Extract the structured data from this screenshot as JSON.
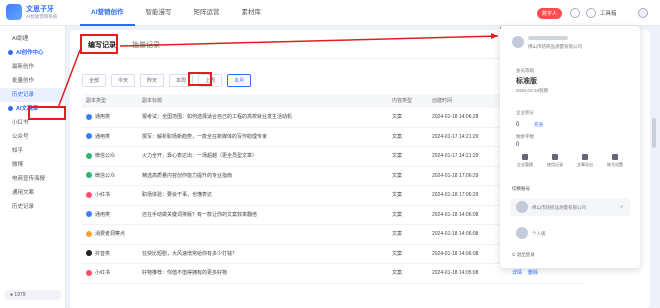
{
  "logo": {
    "title": "文思子牙",
    "subtitle": "AI智能营销系统"
  },
  "nav": [
    "AI营销创作",
    "智能漫写",
    "矩阵运营",
    "素材库"
  ],
  "header": {
    "user_badge": "数字人",
    "tools_label": "工具箱"
  },
  "sidebar": {
    "items": [
      {
        "label": "AI助理",
        "type": "item"
      },
      {
        "label": "AI创作中心",
        "type": "head"
      },
      {
        "label": "最新创作",
        "type": "item"
      },
      {
        "label": "批量创作",
        "type": "item"
      },
      {
        "label": "历史记录",
        "type": "item",
        "active": true
      },
      {
        "label": "AI文案库",
        "type": "head"
      },
      {
        "label": "小红书",
        "type": "item"
      },
      {
        "label": "公众号",
        "type": "item"
      },
      {
        "label": "知乎",
        "type": "item"
      },
      {
        "label": "微博",
        "type": "item"
      },
      {
        "label": "电商宣传海报",
        "type": "item"
      },
      {
        "label": "通用文案",
        "type": "item"
      },
      {
        "label": "历史记录",
        "type": "item"
      }
    ],
    "footer": "1979"
  },
  "tabs": [
    "编写记录",
    "批量记录"
  ],
  "filters": [
    "全部",
    "今天",
    "昨天",
    "本周",
    "上周",
    "本月"
  ],
  "table": {
    "headers": [
      "副本类型",
      "副本标题",
      "内容类型",
      "创建时间"
    ],
    "rows": [
      {
        "type": "通用类",
        "title": "报考试：全国范围：如何选择适合自己的工程的高校就业发生活动机",
        "ctype": "文案",
        "time": "2024-01-18 14:06:28",
        "color": "#3b7cff"
      },
      {
        "type": "通用类",
        "title": "撰写：解析职场新趋势，一款全在新媒体的写作助理专家",
        "ctype": "文案",
        "time": "2024-01-17 14:21:29",
        "color": "#3b7cff"
      },
      {
        "type": "微信公众",
        "title": "火力全开，靠心表达出：一场超越（更全员型文章）",
        "ctype": "文案",
        "time": "2024-01-17 14:21:29",
        "color": "#2bb673"
      },
      {
        "type": "微信公众",
        "title": "精选高质量内容创作能力提升的专业指南",
        "ctype": "文案",
        "time": "2024-01-18 17:06:29",
        "color": "#2bb673"
      },
      {
        "type": "小红书",
        "title": "职场体验：要会干事，也懂表达",
        "ctype": "文案",
        "time": "2024-01-18 17:06:29",
        "color": "#ff4d6a"
      },
      {
        "type": "通用类",
        "title": "还在手动做关键词排版？有一款让你的文案效率翻倍",
        "ctype": "文案",
        "time": "2024-01-18 14:06:08",
        "color": "#3b7cff"
      },
      {
        "type": "消费者洞察点",
        "title": "",
        "ctype": "文案",
        "time": "2024-01-18 14:06:08",
        "color": "#ff9f2e"
      },
      {
        "type": "抖音类",
        "title": "在快比短剧，大风速增常给你有多少打钱？",
        "ctype": "文案",
        "time": "2024-01-18 14:06:08",
        "color": "#222222"
      },
      {
        "type": "小红书",
        "title": "好物推荐：你值不值得拥有的更多好物",
        "ctype": "文案",
        "time": "2024-01-18 14:05:08",
        "color": "#ff4d6a"
      }
    ],
    "row_actions": [
      "详情",
      "删除"
    ]
  },
  "panel": {
    "company": "佛山市纺织品测量有限公司",
    "member_label": "会员等级",
    "member_level": "标准版",
    "member_expiry": "2026-03-18到期",
    "points_label": "企业积分",
    "points": "0",
    "recharge": "充值",
    "words_label": "剩余字数",
    "words": "0",
    "grid": [
      "企业管理",
      "使用记录",
      "文章导出",
      "账号设置"
    ],
    "switch_label": "切换账号",
    "accounts": [
      {
        "name": "佛山市纺织品测量有限公司",
        "checked": true
      },
      {
        "name": "个人版",
        "checked": false
      }
    ],
    "logout": "退出登录"
  }
}
